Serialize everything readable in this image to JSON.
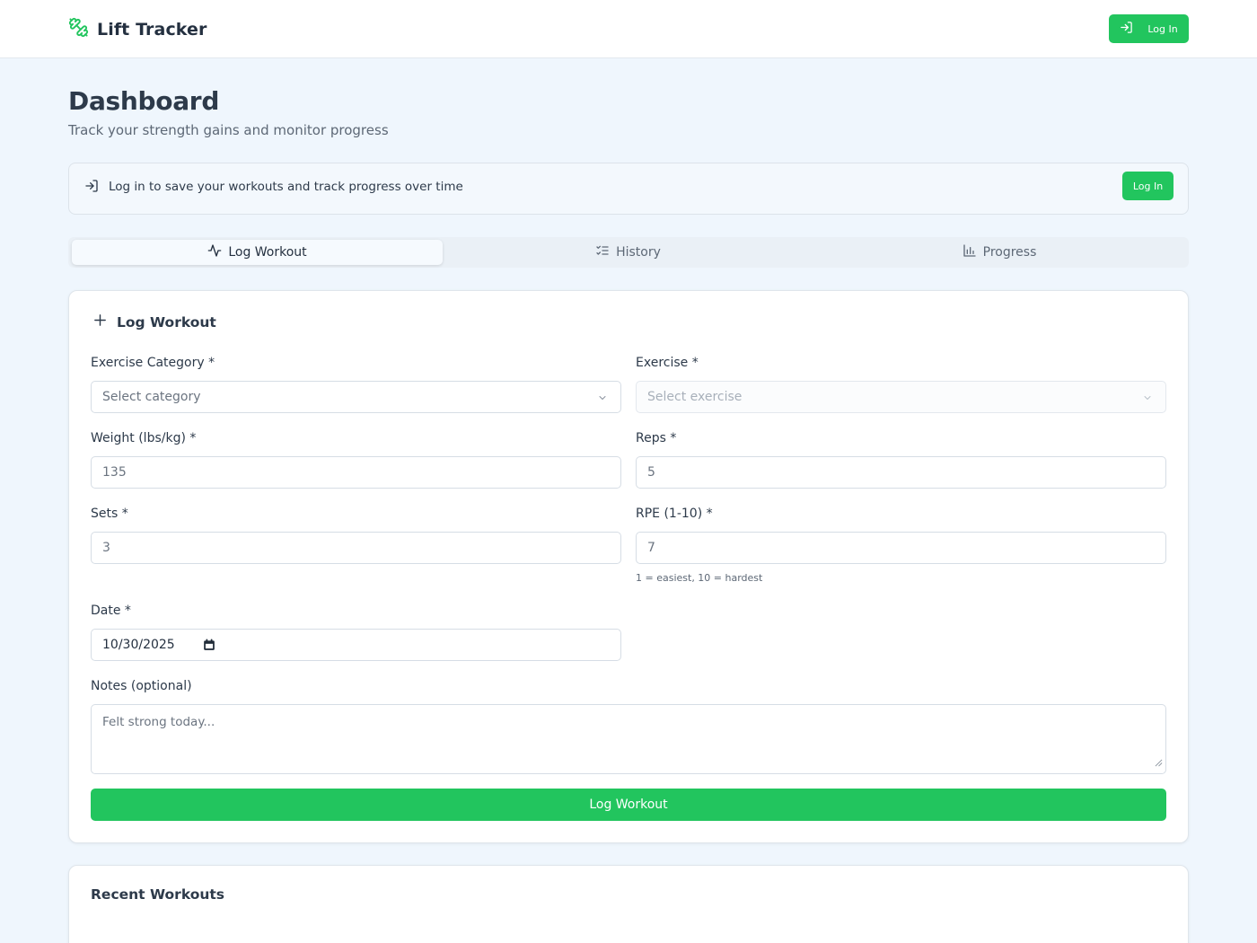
{
  "header": {
    "brand": "Lift Tracker",
    "brand_icon": "dumbbell-icon",
    "login_label": "Log In"
  },
  "page": {
    "title": "Dashboard",
    "subtitle": "Track your strength gains and monitor progress"
  },
  "banner": {
    "text": "Log in to save your workouts and track progress over time",
    "login_label": "Log In"
  },
  "tabs": [
    {
      "label": "Log Workout",
      "icon": "activity-icon",
      "active": true
    },
    {
      "label": "History",
      "icon": "list-check-icon",
      "active": false
    },
    {
      "label": "Progress",
      "icon": "bar-chart-icon",
      "active": false
    }
  ],
  "form": {
    "title": "Log Workout",
    "category": {
      "label": "Exercise Category *",
      "placeholder": "Select category"
    },
    "exercise": {
      "label": "Exercise *",
      "placeholder": "Select exercise"
    },
    "weight": {
      "label": "Weight (lbs/kg) *",
      "placeholder": "135"
    },
    "reps": {
      "label": "Reps *",
      "placeholder": "5"
    },
    "sets": {
      "label": "Sets *",
      "placeholder": "3"
    },
    "rpe": {
      "label": "RPE (1-10) *",
      "placeholder": "7",
      "hint": "1 = easiest, 10 = hardest"
    },
    "date": {
      "label": "Date *",
      "value": "10/30/2025"
    },
    "notes": {
      "label": "Notes (optional)",
      "placeholder": "Felt strong today..."
    },
    "submit_label": "Log Workout"
  },
  "recent": {
    "title": "Recent Workouts"
  },
  "colors": {
    "accent": "#22c55e",
    "background": "#eff6fd"
  }
}
